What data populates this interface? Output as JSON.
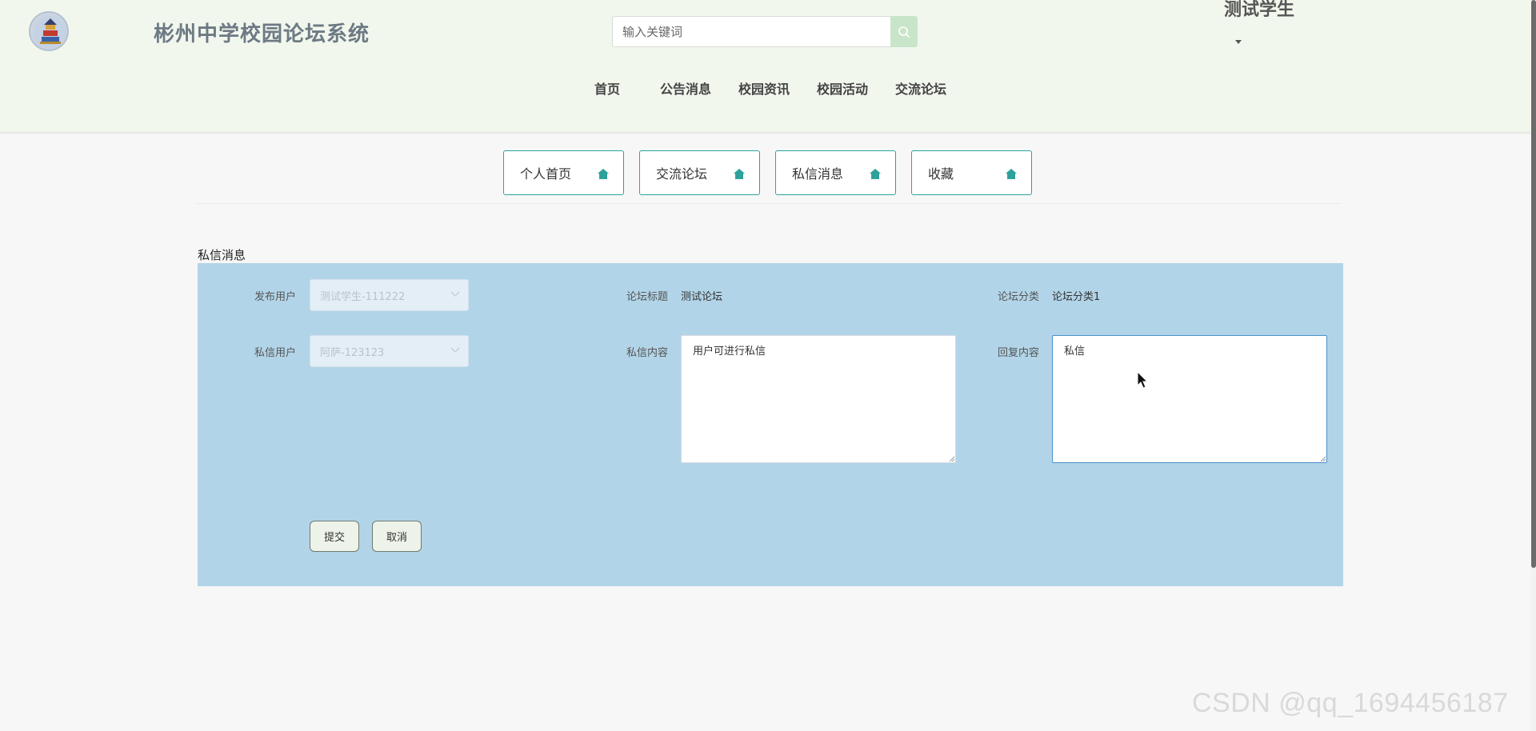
{
  "header": {
    "site_title": "彬州中学校园论坛系统",
    "search_placeholder": "输入关键词",
    "user_name": "测试学生",
    "nav": [
      "首页",
      "公告消息",
      "校园资讯",
      "校园活动",
      "交流论坛"
    ]
  },
  "tabs": [
    "个人首页",
    "交流论坛",
    "私信消息",
    "收藏"
  ],
  "section_title": "私信消息",
  "form": {
    "publisher_label": "发布用户",
    "publisher_value": "测试学生-111222",
    "recipient_label": "私信用户",
    "recipient_value": "阿萨-123123",
    "forum_title_label": "论坛标题",
    "forum_title_value": "测试论坛",
    "forum_category_label": "论坛分类",
    "forum_category_value": "论坛分类1",
    "message_label": "私信内容",
    "message_value": "用户可进行私信",
    "reply_label": "回复内容",
    "reply_value": "私信",
    "submit_label": "提交",
    "cancel_label": "取消"
  },
  "watermark": "CSDN @qq_1694456187",
  "colors": {
    "header_bg": "#f2f7ee",
    "panel_bg": "#b2d4e8",
    "tab_border": "#2da29a",
    "tab_icon": "#2da29a"
  },
  "icons": {
    "logo": "school-logo",
    "search": "search-icon",
    "tab": "house-icon",
    "select": "chevron-down-icon"
  }
}
